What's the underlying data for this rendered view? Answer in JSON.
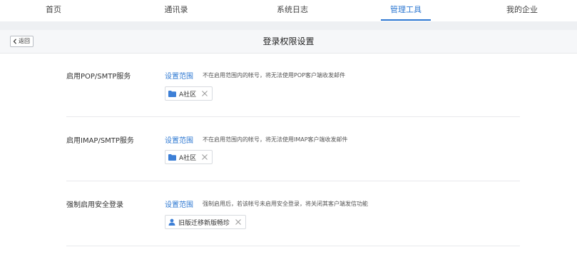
{
  "nav": {
    "tabs": [
      {
        "label": "首页"
      },
      {
        "label": "通讯录"
      },
      {
        "label": "系统日志"
      },
      {
        "label": "管理工具"
      },
      {
        "label": "我的企业"
      }
    ],
    "active_index": 3
  },
  "header": {
    "back_label": "返回",
    "title": "登录权限设置"
  },
  "sections": [
    {
      "label": "启用POP/SMTP服务",
      "link": "设置范围",
      "desc": "不在启用范围内的帐号，将无法使用POP客户端收发邮件",
      "chip": {
        "icon": "folder-icon",
        "text": "A社区"
      }
    },
    {
      "label": "启用IMAP/SMTP服务",
      "link": "设置范围",
      "desc": "不在启用范围内的帐号，将无法使用IMAP客户端收发邮件",
      "chip": {
        "icon": "folder-icon",
        "text": "A社区"
      }
    },
    {
      "label": "强制启用安全登录",
      "link": "设置范围",
      "desc": "强制启用后，若该帐号未启用安全登录，将关闭其客户端发信功能",
      "chip": {
        "icon": "user-icon",
        "text": "旧版迁移新版畅珍"
      }
    }
  ],
  "colors": {
    "accent": "#2e78d2",
    "divider": "#e8e9ec",
    "titlebar_bg": "#f6f7f9"
  }
}
